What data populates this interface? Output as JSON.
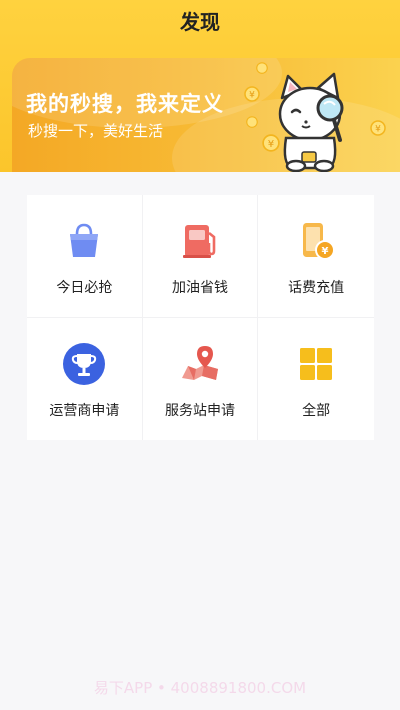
{
  "page": {
    "title": "发现"
  },
  "banner": {
    "title": "我的秒搜，我来定义",
    "subtitle": "秒搜一下，美好生活"
  },
  "menu": {
    "items": [
      {
        "label": "今日必抢",
        "icon": "shopping-bag-icon"
      },
      {
        "label": "加油省钱",
        "icon": "fuel-pump-icon"
      },
      {
        "label": "话费充值",
        "icon": "phone-recharge-icon"
      },
      {
        "label": "运营商申请",
        "icon": "trophy-icon"
      },
      {
        "label": "服务站申请",
        "icon": "map-pin-icon"
      },
      {
        "label": "全部",
        "icon": "grid-icon"
      }
    ]
  },
  "watermark": {
    "text": "易下APP • 4008891800.COM"
  },
  "colors": {
    "header": "#fbc52b",
    "bag": "#6f8cf2",
    "fuel": "#ef6b62",
    "phone": "#f5a623",
    "trophy": "#3b62e0",
    "pin": "#e5574e",
    "grid": "#f6be1c"
  }
}
